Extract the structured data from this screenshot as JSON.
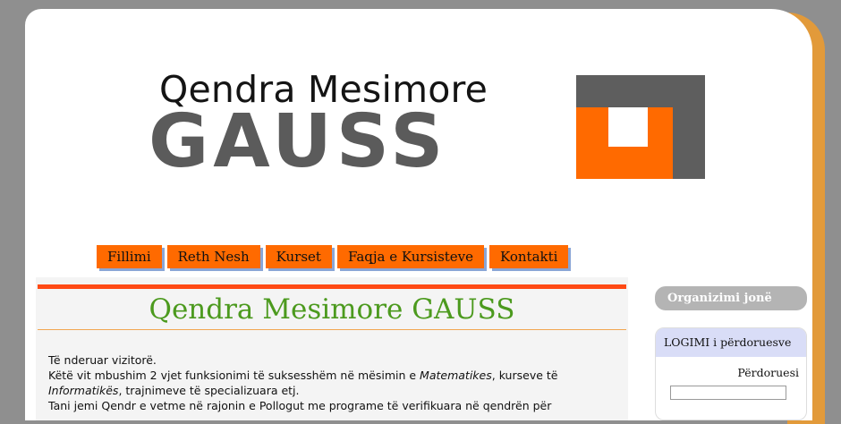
{
  "logo": {
    "line1": "Qendra Mesimore",
    "line2": "GAUSS"
  },
  "nav": {
    "items": [
      "Fillimi",
      "Reth Nesh",
      "Kurset",
      "Faqja e Kursisteve",
      "Kontakti"
    ]
  },
  "main": {
    "title": "Qendra Mesimore GAUSS",
    "paragraphs": {
      "p1": "Të nderuar vizitorë.",
      "p2_a": "Këtë vit mbushim 2 vjet funksionimi të suksesshëm në mësimin e ",
      "p2_b": "Matematikes",
      "p2_c": ", kurseve të",
      "p3_a": "Informatikës",
      "p3_b": ", trajnimeve të specializuara etj.",
      "p4": "Tani jemi Qendr e vetme në rajonin e Pollogut me programe të verifikuara në qendrën për"
    }
  },
  "sidebar": {
    "organization_title": "Organizimi jonë",
    "login_title": "LOGIMI i përdoruesve",
    "username_label": "Përdoruesi",
    "username_value": ""
  },
  "colors": {
    "accent_orange": "#ff6a00",
    "title_green": "#4c9a1e",
    "logo_grey": "#5b5b5b",
    "side_strip": "#e29a3a"
  }
}
